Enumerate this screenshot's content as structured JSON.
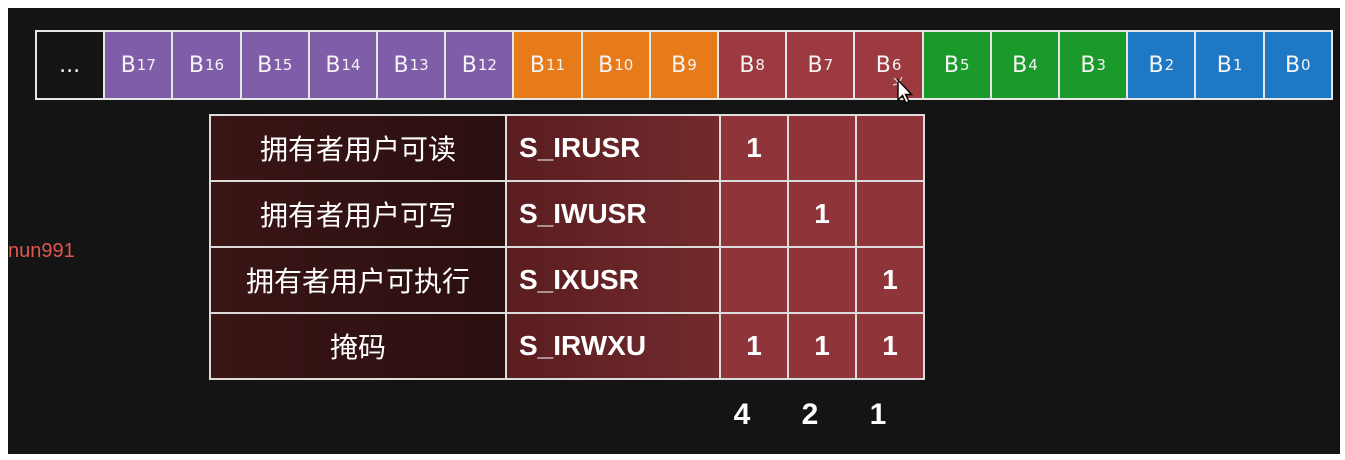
{
  "bits": [
    {
      "base": "...",
      "sub": "",
      "color": "black"
    },
    {
      "base": "B",
      "sub": "17",
      "color": "purple"
    },
    {
      "base": "B",
      "sub": "16",
      "color": "purple"
    },
    {
      "base": "B",
      "sub": "15",
      "color": "purple"
    },
    {
      "base": "B",
      "sub": "14",
      "color": "purple"
    },
    {
      "base": "B",
      "sub": "13",
      "color": "purple"
    },
    {
      "base": "B",
      "sub": "12",
      "color": "purple"
    },
    {
      "base": "B",
      "sub": "11",
      "color": "orange"
    },
    {
      "base": "B",
      "sub": "10",
      "color": "orange"
    },
    {
      "base": "B",
      "sub": "9",
      "color": "orange"
    },
    {
      "base": "B",
      "sub": "8",
      "color": "red"
    },
    {
      "base": "B",
      "sub": "7",
      "color": "red"
    },
    {
      "base": "B",
      "sub": "6",
      "color": "red"
    },
    {
      "base": "B",
      "sub": "5",
      "color": "green"
    },
    {
      "base": "B",
      "sub": "4",
      "color": "green"
    },
    {
      "base": "B",
      "sub": "3",
      "color": "green"
    },
    {
      "base": "B",
      "sub": "2",
      "color": "blue"
    },
    {
      "base": "B",
      "sub": "1",
      "color": "blue"
    },
    {
      "base": "B",
      "sub": "0",
      "color": "blue"
    }
  ],
  "colors": {
    "purple": "#7f5da8",
    "orange": "#e77b1a",
    "red": "#9c3a3f",
    "green": "#1b9a2c",
    "blue": "#1f78c6"
  },
  "rows": [
    {
      "label": "拥有者用户可读",
      "name": "S_IRUSR",
      "v8": "1",
      "v7": "",
      "v6": ""
    },
    {
      "label": "拥有者用户可写",
      "name": "S_IWUSR",
      "v8": "",
      "v7": "1",
      "v6": ""
    },
    {
      "label": "拥有者用户可执行",
      "name": "S_IXUSR",
      "v8": "",
      "v7": "",
      "v6": "1"
    },
    {
      "label": "掩码",
      "name": "S_IRWXU",
      "v8": "1",
      "v7": "1",
      "v6": "1"
    }
  ],
  "weights": [
    "4",
    "2",
    "1"
  ],
  "watermark": "nun991",
  "cursor_icon": "mouse-pointer-icon"
}
